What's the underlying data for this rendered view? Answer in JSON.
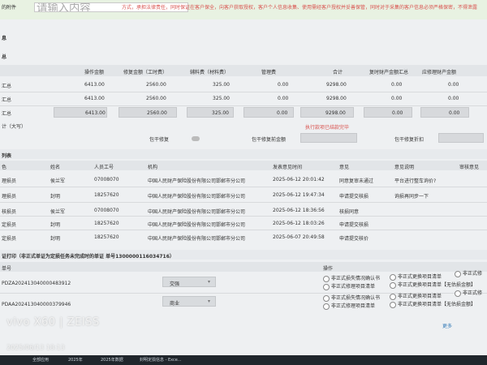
{
  "top": {
    "left_label": "的附件",
    "search_placeholder": "请输入内容",
    "notice_text": "方式，承担法律责任，同时保证在客户保全，向客户获取授权，客户个人信息收集、使用需经客户授权并妥善保管，同时对于采集的客户信息必须严格保密，不得泄露"
  },
  "section_labels": {
    "s1": "息",
    "s2": "总"
  },
  "summary": {
    "columns": [
      "操作金额",
      "修复金额（工时费）",
      "辅料费（材料费）",
      "管理费",
      "合计",
      "复时财产金额汇总",
      "应修理财产金额"
    ],
    "rows": [
      {
        "label": "汇总",
        "values": [
          "6413.00",
          "2560.00",
          "325.00",
          "0.00",
          "9298.00",
          "0.00",
          "0.00"
        ]
      },
      {
        "label": "汇总",
        "values": [
          "6413.00",
          "2560.00",
          "325.00",
          "0.00",
          "9298.00",
          "0.00",
          "0.00"
        ]
      },
      {
        "label": "汇总",
        "values": [
          "6413.00",
          "2560.00",
          "325.00",
          "0.00",
          "9298.00",
          "0.00",
          "0.00"
        ]
      }
    ],
    "big_label": "计（大写）",
    "red_note": "执行款项已结款完毕",
    "repair_items": [
      "包干修复",
      "包干修复前金额",
      "包干修复折扣"
    ]
  },
  "list": {
    "title": "列表",
    "columns": [
      "色",
      "姓名",
      "人员工号",
      "机构",
      "发表意见时间",
      "意见",
      "意见说明",
      "审核意见"
    ],
    "rows": [
      [
        "理损员",
        "侯兰军",
        "07008070",
        "中国人民财产保险股份有限公司邯郸市分公司",
        "2025-06-12 20:01:42",
        "同意复审未通过",
        "平台进行整车询价?"
      ],
      [
        "理损员",
        "封明",
        "18257620",
        "中国人民财产保险股份有限公司邯郸市分公司",
        "2025-06-12 19:47:34",
        "申请提交核损",
        "询损再同步一下"
      ],
      [
        "核损员",
        "侯兰军",
        "07008070",
        "中国人民财产保险股份有限公司邯郸市分公司",
        "2025-06-12 18:36:56",
        "核损同意",
        ""
      ],
      [
        "定损员",
        "封明",
        "18257620",
        "中国人民财产保险股份有限公司邯郸市分公司",
        "2025-06-12 18:03:26",
        "申请提交核损",
        ""
      ],
      [
        "定损员",
        "封明",
        "18257620",
        "中国人民财产保险股份有限公司邯郸市分公司",
        "2025-06-07 20:49:58",
        "申请提交核价",
        ""
      ]
    ]
  },
  "print": {
    "title": "证打印（非正式单证为定损任务未完成时的单证 单号1300000116034716）",
    "col_num": "单号",
    "col_op": "操作",
    "rows": [
      {
        "number": "PDZA202413040000483912",
        "select": "交强",
        "options": [
          "非正式损失情况确认书",
          "非正式修理项目清单",
          "非正式更换项目清单",
          "非正式更换项目清单【无估损金额】",
          "非正式修"
        ]
      },
      {
        "number": "PDAA202413040000379946",
        "select": "商业",
        "options": [
          "非正式损失情况确认书",
          "非正式修理项目清单",
          "非正式更换项目清单",
          "非正式更换项目清单【无估损金额】",
          "非正式修"
        ]
      }
    ],
    "more_link": "更多"
  },
  "watermark": {
    "brand": "vivo X60 | ZEISS",
    "datetime": "2025/06/13 18:13"
  },
  "taskbar": {
    "items": [
      "全部应用",
      "2025年",
      "2025年数据",
      "封明定损信息 - Exce..."
    ]
  }
}
